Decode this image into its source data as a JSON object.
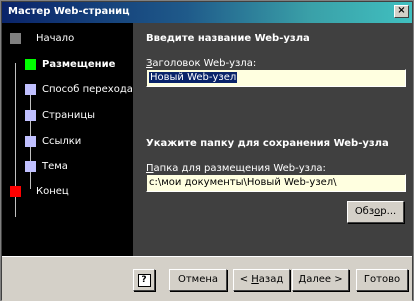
{
  "window": {
    "title": "Мастер Web-страниц",
    "close_label": "×"
  },
  "nav": {
    "items": [
      {
        "label": "Начало",
        "color": "#808080"
      },
      {
        "label": "Размещение",
        "color": "#00ff00"
      },
      {
        "label": "Способ перехода",
        "color": "#c0c0ff"
      },
      {
        "label": "Страницы",
        "color": "#c0c0ff"
      },
      {
        "label": "Ссылки",
        "color": "#c0c0ff"
      },
      {
        "label": "Тема",
        "color": "#c0c0ff"
      },
      {
        "label": "Конец",
        "color": "#ff0000"
      }
    ],
    "active_index": 1
  },
  "form": {
    "heading1": "Введите название Web-узла",
    "title_label_hotkey": "З",
    "title_label_rest": "аголовок Web-узла:",
    "title_value": "Новый Web-узел",
    "heading2": "Укажите папку для сохранения Web-узла",
    "folder_label_hotkey": "П",
    "folder_label_rest": "апка для размещения Web-узла:",
    "folder_value": "c:\\мои документы\\Новый Web-узел\\",
    "browse_label_pre": "Обз",
    "browse_label_hotkey": "о",
    "browse_label_post": "р..."
  },
  "buttons": {
    "help": "?",
    "cancel": "Отмена",
    "back_pre": "< ",
    "back_hotkey": "Н",
    "back_post": "азад",
    "next_hotkey": "Д",
    "next_post": "алее >",
    "finish": "Готово"
  }
}
